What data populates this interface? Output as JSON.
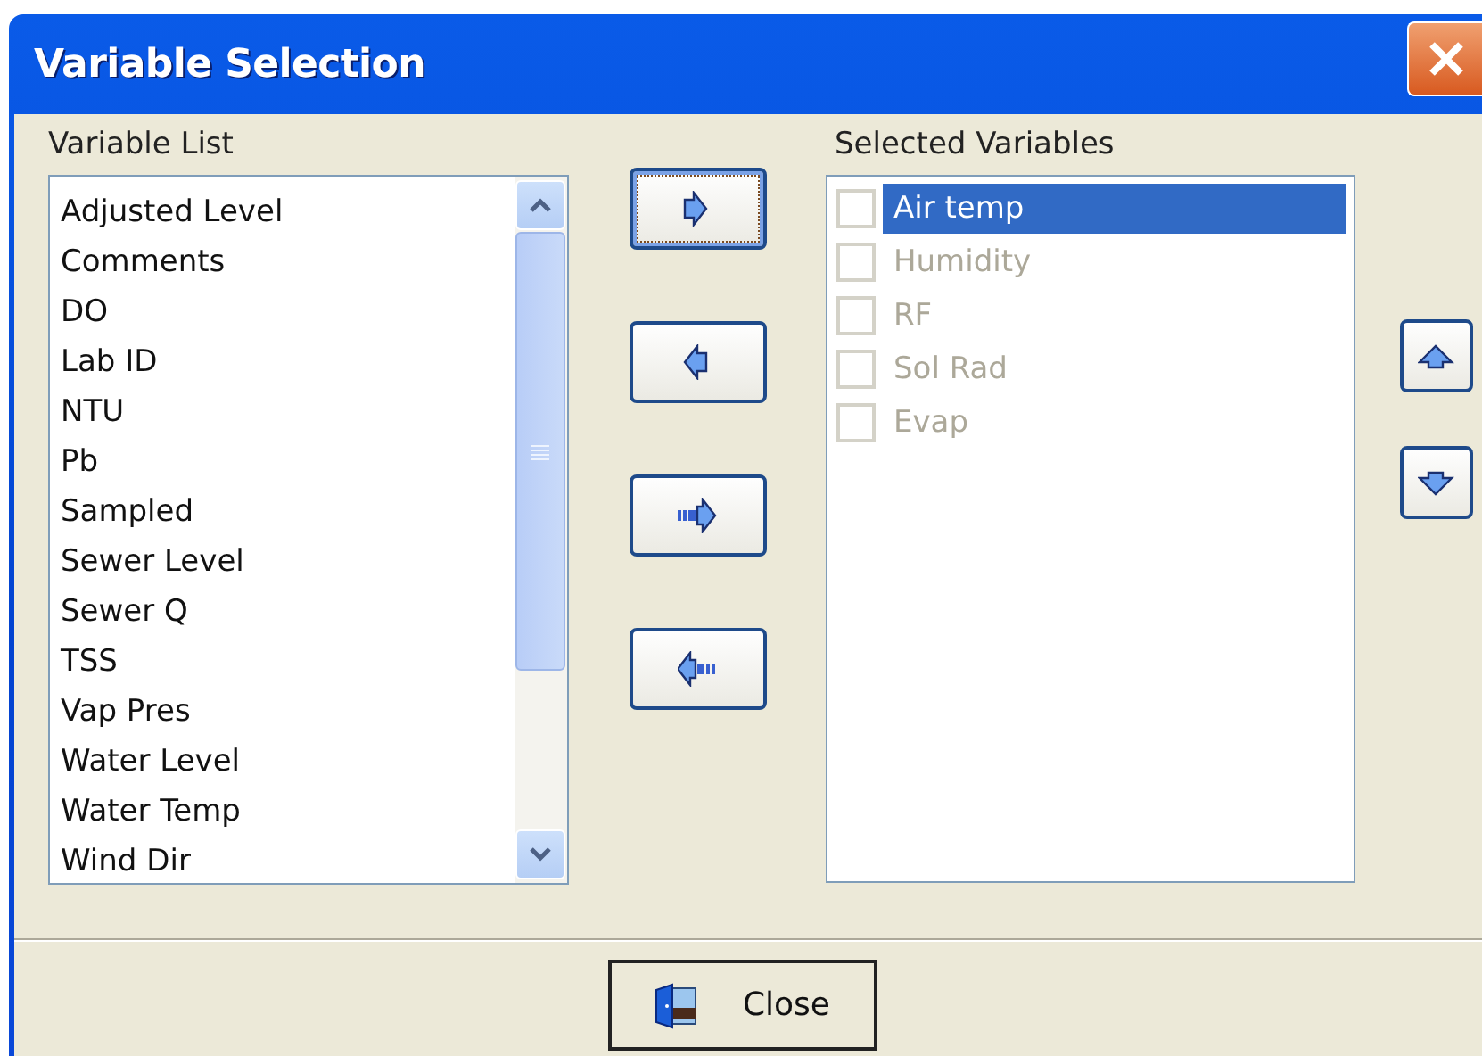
{
  "window": {
    "title": "Variable Selection"
  },
  "variable_list": {
    "label": "Variable List",
    "items": [
      "Adjusted Level",
      "Comments",
      "DO",
      "Lab ID",
      "NTU",
      "Pb",
      "Sampled",
      "Sewer Level",
      "Sewer Q",
      "TSS",
      "Vap Pres",
      "Water Level",
      "Water Temp",
      "Wind Dir"
    ]
  },
  "transfer_buttons": [
    {
      "kind": "add",
      "focused": true
    },
    {
      "kind": "remove",
      "focused": false
    },
    {
      "kind": "add-all",
      "focused": false
    },
    {
      "kind": "remove-all",
      "focused": false
    }
  ],
  "selected_variables": {
    "label": "Selected Variables",
    "items": [
      {
        "name": "Air temp",
        "checked": false,
        "selected": true,
        "disabled": false
      },
      {
        "name": "Humidity",
        "checked": false,
        "selected": false,
        "disabled": true
      },
      {
        "name": "RF",
        "checked": false,
        "selected": false,
        "disabled": true
      },
      {
        "name": "Sol Rad",
        "checked": false,
        "selected": false,
        "disabled": true
      },
      {
        "name": "Evap",
        "checked": false,
        "selected": false,
        "disabled": true
      }
    ]
  },
  "order_buttons": [
    {
      "kind": "up"
    },
    {
      "kind": "down"
    }
  ],
  "close_button": {
    "label": "Close"
  }
}
